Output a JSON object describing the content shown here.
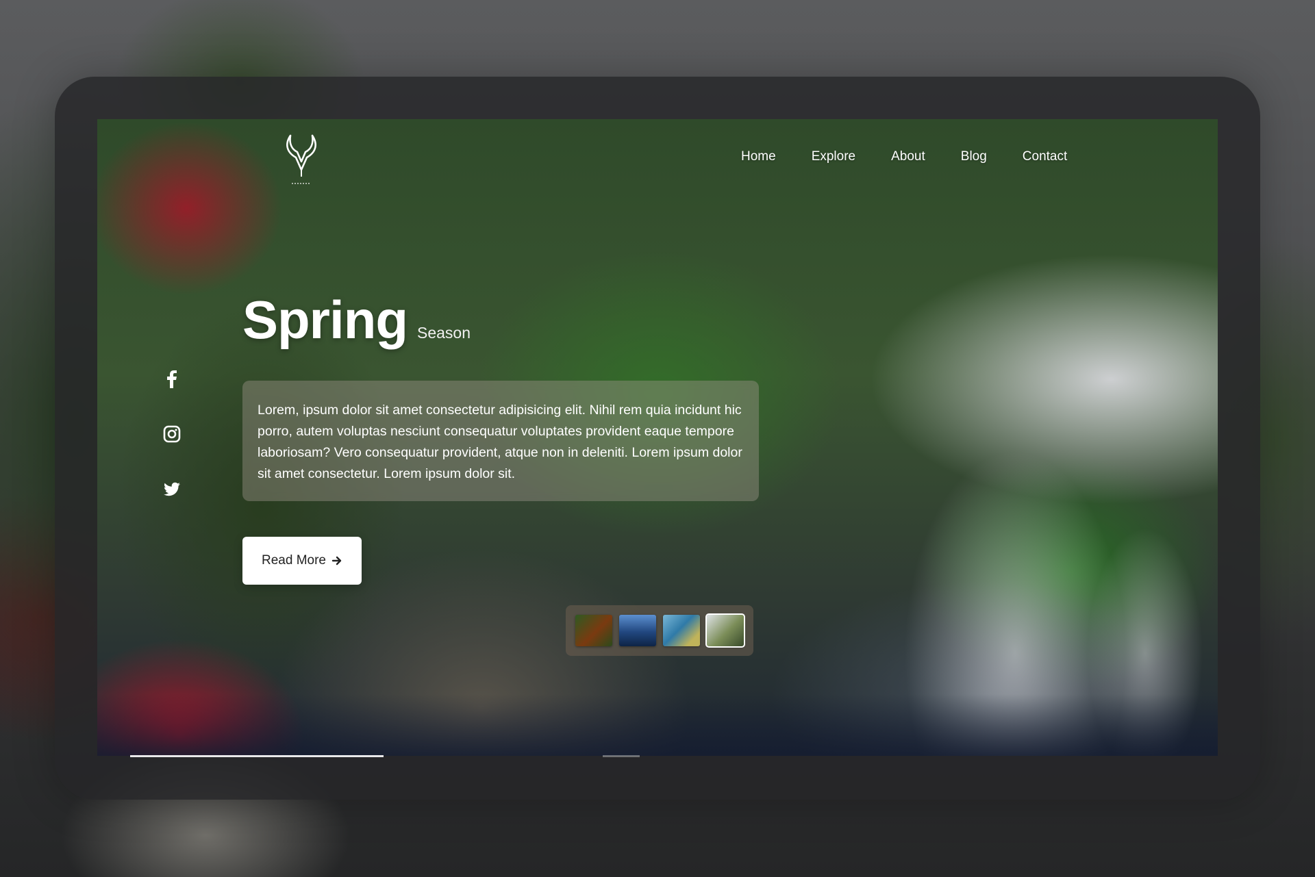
{
  "nav": {
    "items": [
      "Home",
      "Explore",
      "About",
      "Blog",
      "Contact"
    ]
  },
  "hero": {
    "title": "Spring",
    "subtitle": "Season",
    "description": "Lorem, ipsum dolor sit amet consectetur adipisicing elit. Nihil rem quia incidunt hic porro, autem voluptas nesciunt consequatur voluptates provident eaque tempore laboriosam? Vero consequatur provident, atque non in deleniti. Lorem ipsum dolor sit amet consectetur. Lorem ipsum dolor sit.",
    "button_label": "Read More",
    "button_icon": "arrow-right-icon"
  },
  "social": [
    "facebook-icon",
    "instagram-icon",
    "twitter-icon"
  ],
  "gallery": {
    "thumbnails": [
      "forest-thumbnail",
      "lake-night-thumbnail",
      "lake-day-thumbnail",
      "waterfall-thumbnail"
    ],
    "active_index": 3
  },
  "slider": {
    "progress": 0.25
  },
  "colors": {
    "text": "#ffffff",
    "button_bg": "#ffffff",
    "button_text": "#222222"
  }
}
